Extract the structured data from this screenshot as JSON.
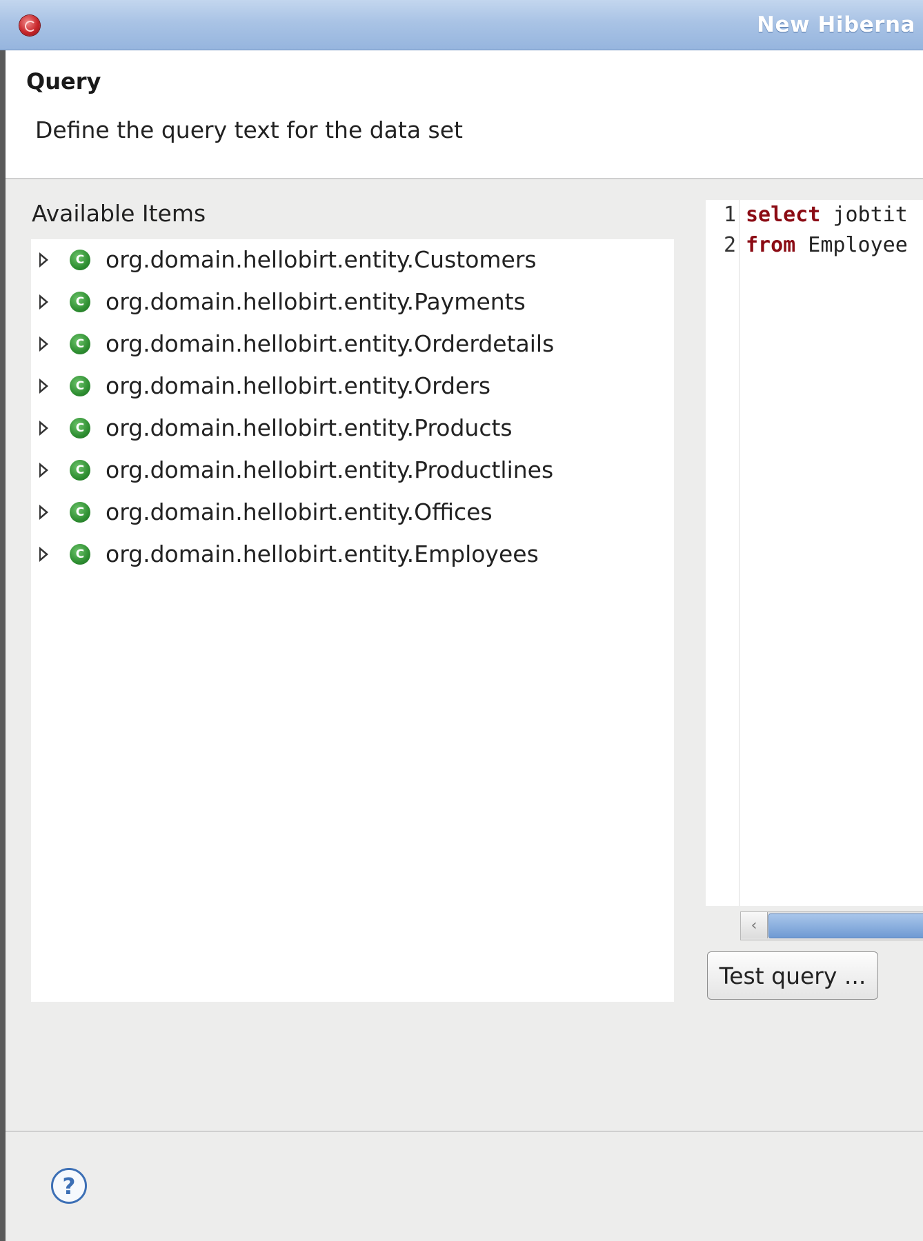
{
  "window": {
    "title": "New Hiberna",
    "icon": "app-logo-icon"
  },
  "header": {
    "title": "Query",
    "description": "Define the query text for the data set"
  },
  "available_items": {
    "label": "Available Items",
    "class_icon_letter": "C",
    "items": [
      {
        "label": "org.domain.hellobirt.entity.Customers"
      },
      {
        "label": "org.domain.hellobirt.entity.Payments"
      },
      {
        "label": "org.domain.hellobirt.entity.Orderdetails"
      },
      {
        "label": "org.domain.hellobirt.entity.Orders"
      },
      {
        "label": "org.domain.hellobirt.entity.Products"
      },
      {
        "label": "org.domain.hellobirt.entity.Productlines"
      },
      {
        "label": "org.domain.hellobirt.entity.Offices"
      },
      {
        "label": "org.domain.hellobirt.entity.Employees"
      }
    ]
  },
  "editor": {
    "lines": [
      {
        "number": "1",
        "keyword": "select",
        "rest": " jobtit"
      },
      {
        "number": "2",
        "keyword": "from",
        "rest": " Employee"
      }
    ]
  },
  "scrollbar": {
    "left_arrow": "‹"
  },
  "buttons": {
    "test_query": "Test query ..."
  },
  "footer": {
    "help_glyph": "?"
  },
  "colors": {
    "titlebar": "#a9c3e5",
    "keyword": "#8b0b14",
    "class_icon": "#2f8f32",
    "help_icon": "#3c6fb5"
  }
}
